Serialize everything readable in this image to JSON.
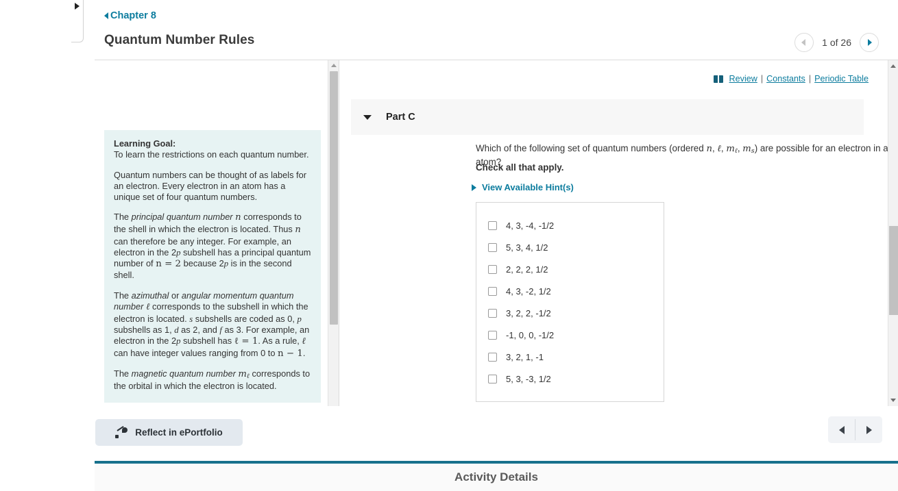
{
  "rail": {
    "expand_icon": "triangle-right-icon"
  },
  "header": {
    "chapter_link": "Chapter 8",
    "title": "Quantum Number Rules",
    "pager": {
      "prev_icon": "chevron-left-icon",
      "next_icon": "chevron-right-icon",
      "label": "1 of 26"
    }
  },
  "utility": {
    "book_icon": "book-icon",
    "review": "Review",
    "separator": "|",
    "constants": "Constants",
    "periodic_table": "Periodic Table",
    "link_color": "#0c7c9e"
  },
  "intro": {
    "goal_title": "Learning Goal:",
    "goal_text": "To learn the restrictions on each quantum number.",
    "paragraph2": "Quantum numbers can be thought of as labels for an electron. Every electron in an atom has a unique set of four quantum numbers.",
    "p3_a": "The ",
    "p3_em": "principal quantum number",
    "p3_n1": "n",
    "p3_b": " corresponds to the shell in which the electron is located. Thus ",
    "p3_n2": "n",
    "p3_c": " can therefore be any integer. For example, an electron in the 2",
    "p3_p1": "p",
    "p3_d": " subshell has a principal quantum number of ",
    "p3_eq": "n = 2",
    "p3_e": " because 2",
    "p3_p2": "p",
    "p3_f": " is in the second shell.",
    "p4_a": "The ",
    "p4_em1": "azimuthal",
    "p4_b": " or ",
    "p4_em2": "angular momentum quantum number",
    "p4_l1": "ℓ",
    "p4_c": " corresponds to the subshell in which the electron is located. ",
    "p4_s": "s",
    "p4_d": " subshells are coded as 0, ",
    "p4_p": "p",
    "p4_e": " subshells as 1, ",
    "p4_dd": "d",
    "p4_f": " as 2, and ",
    "p4_ff": "f",
    "p4_g": " as 3. For example, an electron in the 2",
    "p4_p2": "p",
    "p4_h": " subshell has ",
    "p4_eq": "ℓ = 1",
    "p4_i": ". As a rule, ",
    "p4_l2": "ℓ",
    "p4_j": " can have integer values ranging from 0 to ",
    "p4_eq2": "n − 1",
    "p4_k": ".",
    "p5_a": "The ",
    "p5_em": "magnetic quantum number",
    "p5_m": "m",
    "p5_msub": "ℓ",
    "p5_b": " corresponds to the orbital in which the electron is located.",
    "background": "#e7f3f3"
  },
  "question": {
    "part_label": "Part C",
    "caret_icon": "caret-down-icon",
    "q_a": "Which of the following set of quantum numbers (ordered ",
    "q_n": "n",
    "q_c1": ", ",
    "q_l": "ℓ",
    "q_c2": ", ",
    "q_m": "m",
    "q_msub": "ℓ",
    "q_c3": ", ",
    "q_ms": "m",
    "q_mssub": "s",
    "q_b": ") are possible for an electron in an atom?",
    "check_all": "Check all that apply.",
    "hints_icon": "triangle-right-icon",
    "hints_label": "View Available Hint(s)",
    "choices": [
      {
        "label": "4, 3, -4, -1/2",
        "checked": false
      },
      {
        "label": "5, 3, 4, 1/2",
        "checked": false
      },
      {
        "label": "2, 2, 2, 1/2",
        "checked": false
      },
      {
        "label": "4, 3, -2, 1/2",
        "checked": false
      },
      {
        "label": "3, 2, 2, -1/2",
        "checked": false
      },
      {
        "label": "-1, 0, 0, -1/2",
        "checked": false
      },
      {
        "label": "3, 2, 1, -1",
        "checked": false
      },
      {
        "label": "5, 3, -3, 1/2",
        "checked": false
      }
    ]
  },
  "footer": {
    "eportfolio_label": "Reflect in ePortfolio",
    "eportfolio_icon": "quill-icon",
    "prev_icon": "chevron-left-icon",
    "next_icon": "chevron-right-icon"
  },
  "activity": {
    "title": "Activity Details",
    "accent": "#17708c"
  }
}
